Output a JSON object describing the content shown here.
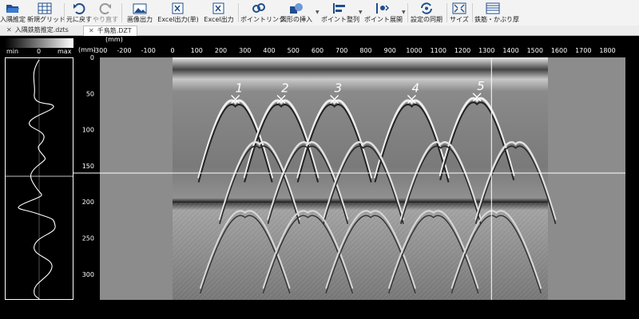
{
  "toolbar": {
    "items": [
      {
        "label": "入隅推定",
        "icon": "folder-open-icon"
      },
      {
        "label": "新規グリッド",
        "icon": "grid-icon"
      },
      {
        "label": "元に戻す",
        "icon": "undo-icon"
      },
      {
        "label": "やり直す",
        "icon": "redo-icon"
      },
      {
        "label": "画像出力",
        "icon": "image-export-icon"
      },
      {
        "label": "Excel出力(単)",
        "icon": "excel-single-icon"
      },
      {
        "label": "Excel出力",
        "icon": "excel-icon"
      },
      {
        "label": "ポイントリンク",
        "icon": "link-icon"
      },
      {
        "label": "図形の挿入",
        "icon": "shape-icon"
      },
      {
        "label": "ポイント整列",
        "icon": "align-icon"
      },
      {
        "label": "ポイント展開",
        "icon": "expand-icon"
      },
      {
        "label": "設定の同期",
        "icon": "sync-icon"
      },
      {
        "label": "サイズ",
        "icon": "resize-icon"
      },
      {
        "label": "鉄筋・かぶり厚",
        "icon": "rebar-icon"
      }
    ]
  },
  "tabs": [
    {
      "label": "入隅鉄筋推定.dzts",
      "active": false
    },
    {
      "label": "千鳥筋.DZT",
      "active": true
    }
  ],
  "colorbar": {
    "min_label": "min",
    "zero_label": "0",
    "max_label": "max"
  },
  "axes": {
    "x_unit": "(mm)",
    "y_unit": "(mm)",
    "x_ticks": [
      "-300",
      "-200",
      "-100",
      "0",
      "100",
      "200",
      "300",
      "400",
      "500",
      "600",
      "700",
      "800",
      "900",
      "1000",
      "1100",
      "1200",
      "1300",
      "1400",
      "1500",
      "1600",
      "1700",
      "1800"
    ],
    "y_ticks": [
      "0",
      "50",
      "100",
      "150",
      "200",
      "250",
      "300"
    ]
  },
  "points": [
    {
      "label": "1",
      "x_mm": 260,
      "depth_mm": 58
    },
    {
      "label": "2",
      "x_mm": 450,
      "depth_mm": 58
    },
    {
      "label": "3",
      "x_mm": 670,
      "depth_mm": 58
    },
    {
      "label": "4",
      "x_mm": 990,
      "depth_mm": 58
    },
    {
      "label": "5",
      "x_mm": 1260,
      "depth_mm": 55
    }
  ],
  "cursor": {
    "x_mm": 1320,
    "depth_mm": 160
  },
  "colors": {
    "background": "#000000",
    "viewport": "#8c8c8c",
    "grid_line": "#ffffff"
  }
}
